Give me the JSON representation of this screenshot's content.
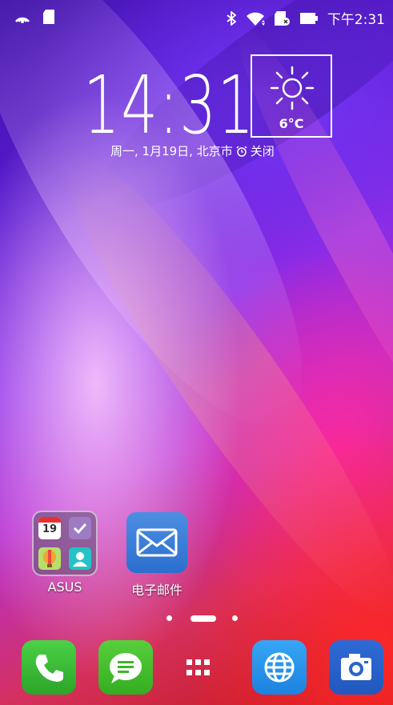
{
  "status_bar": {
    "time": "下午2:31",
    "icons": [
      "nfc-icon",
      "sdcard-icon",
      "bluetooth-icon",
      "wifi-icon",
      "sim-icon",
      "battery-icon"
    ]
  },
  "clock_widget": {
    "time": "14:31",
    "date": "周一, 1月19日, 北京市",
    "alarm_status": "关闭",
    "weather": {
      "temperature": "6°C",
      "condition_icon": "sun-icon"
    }
  },
  "home": {
    "folder": {
      "label": "ASUS",
      "calendar_day": "19"
    },
    "email": {
      "label": "电子邮件"
    }
  },
  "page_indicator": {
    "pages": 3,
    "current": 2
  },
  "dock": [
    "phone-icon",
    "messages-icon",
    "app-drawer-icon",
    "browser-icon",
    "camera-icon"
  ],
  "colors": {
    "phone": "#3dbf38",
    "messages": "#45be2e",
    "browser": "#2a95ea",
    "camera": "#2864cc",
    "email": "#3b7fd9"
  }
}
